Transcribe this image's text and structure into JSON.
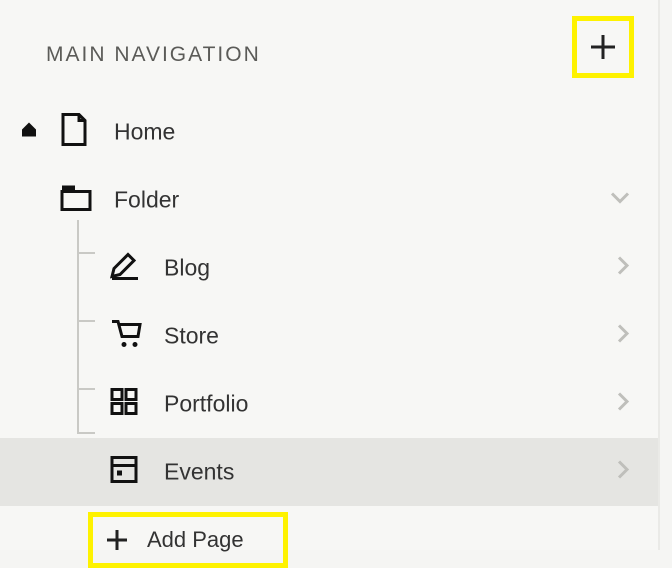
{
  "header": {
    "title": "MAIN NAVIGATION"
  },
  "nav": {
    "home_label": "Home",
    "folder_label": "Folder",
    "children": [
      {
        "label": "Blog",
        "icon": "pen-icon"
      },
      {
        "label": "Store",
        "icon": "cart-icon"
      },
      {
        "label": "Portfolio",
        "icon": "grid-icon"
      },
      {
        "label": "Events",
        "icon": "calendar-icon"
      }
    ],
    "add_page_label": "Add Page"
  },
  "highlight_color": "#fef200"
}
